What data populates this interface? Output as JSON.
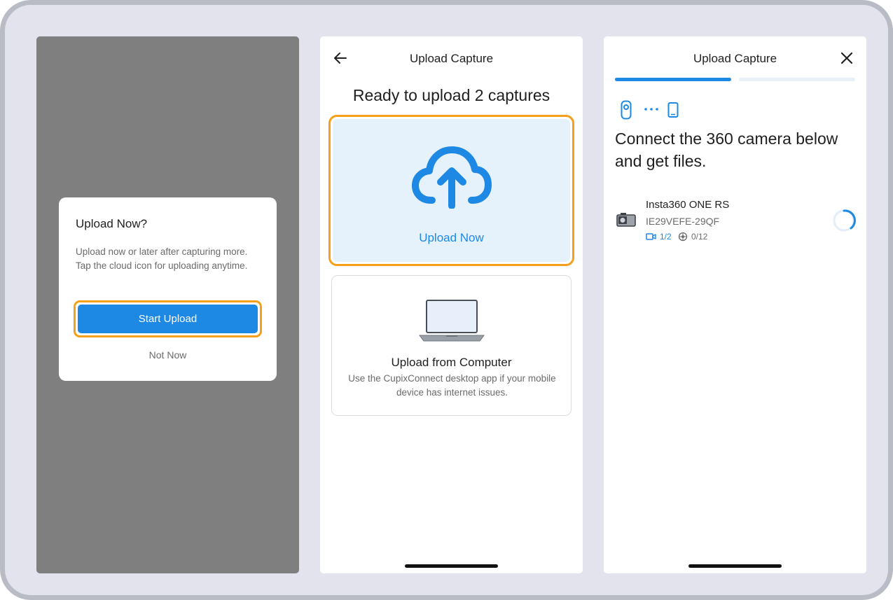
{
  "colors": {
    "accent": "#1e88e5",
    "highlight": "#f5a01a",
    "overlay": "#7f7f7f",
    "card_bg": "#e5f1fb"
  },
  "panel1": {
    "dialog": {
      "title": "Upload Now?",
      "body": "Upload now or later after capturing more. Tap the cloud icon for uploading anytime.",
      "primary_label": "Start Upload",
      "secondary_label": "Not Now"
    }
  },
  "panel2": {
    "header": {
      "back_icon": "arrow-left-icon",
      "title": "Upload Capture"
    },
    "heading": "Ready to upload 2 captures",
    "upload_now": {
      "icon": "cloud-upload-icon",
      "label": "Upload Now"
    },
    "computer": {
      "icon": "laptop-icon",
      "title": "Upload from Computer",
      "description": "Use the CupixConnect desktop app if your mobile device has internet issues."
    }
  },
  "panel3": {
    "header": {
      "title": "Upload Capture",
      "close_icon": "close-icon"
    },
    "progress": {
      "step": 1,
      "total_steps": 2
    },
    "connection_icons": [
      "camera-icon",
      "dots-icon",
      "phone-icon"
    ],
    "heading": "Connect the 360 camera below and get files.",
    "device": {
      "icon": "360-camera-icon",
      "name": "Insta360 ONE RS",
      "serial": "IE29VEFE-29QF",
      "video_count": "1/2",
      "photo_count": "0/12",
      "status_icon": "loading-spinner-icon"
    }
  }
}
